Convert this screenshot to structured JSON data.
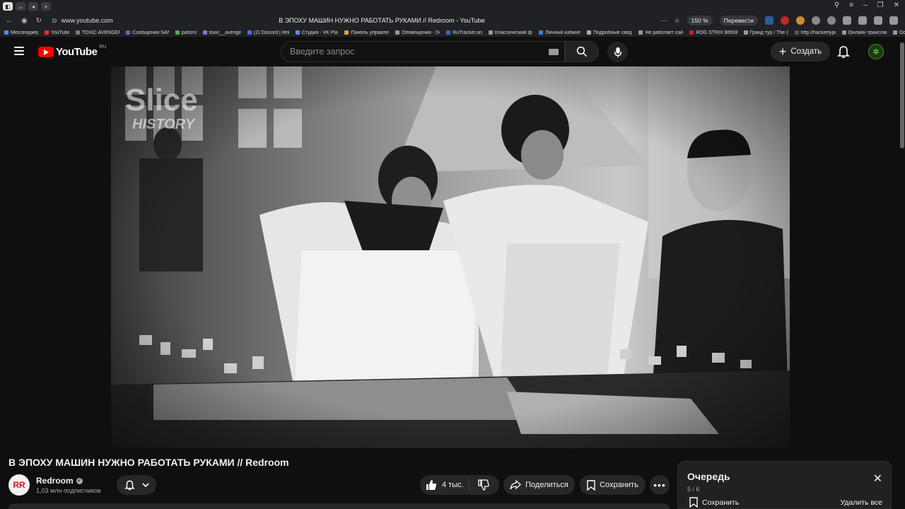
{
  "browser": {
    "url": "www.youtube.com",
    "tab_title": "В ЭПОХУ МАШИН НУЖНО РАБОТАТЬ РУКАМИ // Redroom - YouTube",
    "zoom": "150 %",
    "translate_label": "Перевести"
  },
  "bookmarks": [
    "Мессенджер",
    "YouTube",
    "TOXIC AVENGER",
    "Сообщения SAN",
    "работа",
    "toxic__avenger",
    "(2) Discord | #elit",
    "Студия - VK Play",
    "Панель управлен",
    "Оповещения - Do",
    "RuTracker.org",
    "Классический фо",
    "Личный кабинет",
    "Подробные сведе",
    "Не работает сайт",
    "ROG STRIX B650E",
    "Гранд тур / The G",
    "http://hackertype",
    "Онлайн трансляц",
    "Ос"
  ],
  "header": {
    "logo_text": "YouTube",
    "country_code": "RU",
    "search_placeholder": "Введите запрос",
    "create_label": "Создать"
  },
  "video": {
    "watermark_line1": "Slice",
    "watermark_line2": "HISTORY",
    "title": "В ЭПОХУ МАШИН НУЖНО РАБОТАТЬ РУКАМИ // Redroom"
  },
  "channel": {
    "name": "Redroom",
    "subscribers": "1,03 млн подписчиков",
    "avatar_letters": "RR"
  },
  "actions": {
    "likes": "4 тыс.",
    "share_label": "Поделиться",
    "save_label": "Сохранить"
  },
  "queue": {
    "title": "Очередь",
    "count": "5 / 6",
    "save_label": "Сохранить",
    "delete_all_label": "Удалить все"
  }
}
